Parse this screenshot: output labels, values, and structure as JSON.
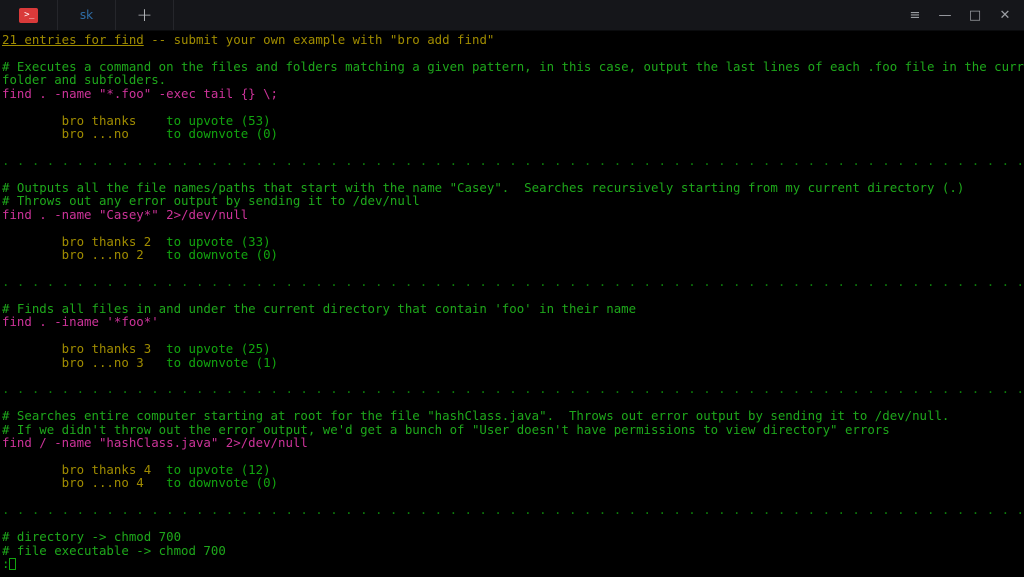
{
  "window": {
    "tabs": [
      {
        "label": "",
        "icon": "terminal-icon",
        "active": true
      },
      {
        "label": "sk",
        "icon": "",
        "active": false
      }
    ],
    "new_tab_label": "+",
    "controls": {
      "menu": "≡",
      "minimize": "—",
      "maximize": "□",
      "close": "✕"
    }
  },
  "terminal": {
    "header": {
      "underlined": "21 entries for find",
      "rest": " -- submit your own example with \"bro add find\""
    },
    "separator": ". . . . . . . . . . . . . . . . . . . . . . . . . . . . . . . . . . . . . . . . . . . . . . . . . . . . . . . . . . . . . . . . . . . . . . . . . . . . . . . . . . . . . . . . . . . . . . . . . . . . . .",
    "prompt": ":",
    "entries": [
      {
        "comments": [
          "# Executes a command on the files and folders matching a given pattern, in this case, output the last lines of each .foo file in the current",
          "folder and subfolders."
        ],
        "command": "find . -name \"*.foo\" -exec tail {} \\;",
        "upvote_cmd": "bro thanks",
        "upvote_text": "to upvote (53)",
        "downvote_cmd": "bro ...no",
        "downvote_text": "to downvote (0)"
      },
      {
        "comments": [
          "# Outputs all the file names/paths that start with the name \"Casey\".  Searches recursively starting from my current directory (.)",
          "# Throws out any error output by sending it to /dev/null"
        ],
        "command": "find . -name \"Casey*\" 2>/dev/null",
        "upvote_cmd": "bro thanks 2",
        "upvote_text": "to upvote (33)",
        "downvote_cmd": "bro ...no 2",
        "downvote_text": "to downvote (0)"
      },
      {
        "comments": [
          "# Finds all files in and under the current directory that contain 'foo' in their name"
        ],
        "command": "find . -iname '*foo*'",
        "upvote_cmd": "bro thanks 3",
        "upvote_text": "to upvote (25)",
        "downvote_cmd": "bro ...no 3",
        "downvote_text": "to downvote (1)"
      },
      {
        "comments": [
          "# Searches entire computer starting at root for the file \"hashClass.java\".  Throws out error output by sending it to /dev/null.",
          "# If we didn't throw out the error output, we'd get a bunch of \"User doesn't have permissions to view directory\" errors"
        ],
        "command": "find / -name \"hashClass.java\" 2>/dev/null",
        "upvote_cmd": "bro thanks 4",
        "upvote_text": "to upvote (12)",
        "downvote_cmd": "bro ...no 4",
        "downvote_text": "to downvote (0)"
      },
      {
        "comments": [
          "# directory -> chmod 700",
          "# file executable -> chmod 700"
        ],
        "command": "",
        "upvote_cmd": "",
        "upvote_text": "",
        "downvote_cmd": "",
        "downvote_text": ""
      }
    ]
  },
  "colors": {
    "background": "#000000",
    "titlebar": "#15161a",
    "comment_green": "#1ea81b",
    "command_magenta": "#cc3399",
    "vote_yellow": "#a08c00",
    "vote_green": "#12a50f",
    "tab_accent": "#d93a3a",
    "tab_label": "#2f6ea8"
  }
}
